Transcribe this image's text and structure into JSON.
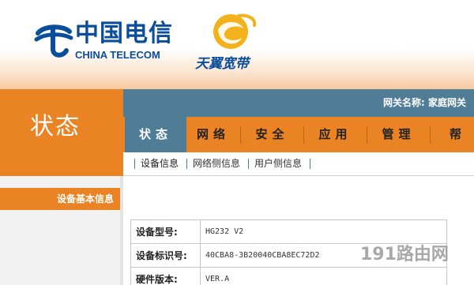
{
  "brand": {
    "company_cn": "中国电信",
    "company_en": "CHINA TELECOM",
    "product_cn": "天翼宽带",
    "colors": {
      "blue": "#0a4e9b",
      "orange": "#ea8324",
      "teal": "#4f7d96",
      "yellow": "#f3b21c"
    }
  },
  "status_section": {
    "title": "状态"
  },
  "gateway": {
    "label": "网关名称: 家庭网关"
  },
  "main_nav": {
    "tabs": [
      {
        "label": "状态",
        "active": true
      },
      {
        "label": "网络",
        "active": false
      },
      {
        "label": "安全",
        "active": false
      },
      {
        "label": "应用",
        "active": false
      },
      {
        "label": "管理",
        "active": false
      },
      {
        "label": "帮助",
        "active": false
      }
    ]
  },
  "sub_nav": {
    "items": [
      {
        "label": "设备信息",
        "active": true
      },
      {
        "label": "网络侧信息",
        "active": false
      },
      {
        "label": "用户侧信息",
        "active": false
      }
    ]
  },
  "sidebar": {
    "section_title": "设备基本信息"
  },
  "device_info": {
    "rows": [
      {
        "label": "设备型号:",
        "value": "HG232 V2"
      },
      {
        "label": "设备标识号:",
        "value": "40CBA8-3B20040CBA8EC72D2"
      },
      {
        "label": "硬件版本:",
        "value": "VER.A"
      }
    ]
  },
  "watermark": {
    "text": "191路由网"
  }
}
